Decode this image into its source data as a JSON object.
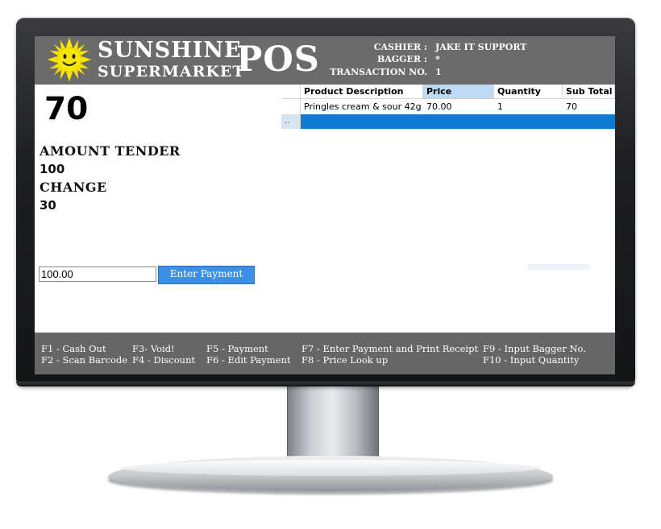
{
  "brand": {
    "name": "SUNSHINE",
    "sub": "SUPERMARKET",
    "pos": "POS",
    "logo": "smiling-sun-icon",
    "colors": {
      "sun": "#f7e600",
      "header": "#6b6b6b"
    }
  },
  "info": {
    "cashier_label": "CASHIER :",
    "cashier_value": "JAKE IT SUPPORT",
    "bagger_label": "BAGGER :",
    "bagger_value": "*",
    "transaction_label": "TRANSACTION NO.",
    "transaction_value": "1"
  },
  "summary": {
    "total": "70",
    "amount_tender_label": "AMOUNT TENDER",
    "amount_tender_value": "100",
    "change_label": "CHANGE",
    "change_value": "30"
  },
  "payment": {
    "input_value": "100.00",
    "button_label": "Enter Payment"
  },
  "grid": {
    "columns": [
      "Product Description",
      "Price",
      "Quantity",
      "Sub Total"
    ],
    "selected_column": "Price",
    "rows": [
      [
        "Pringles cream & sour 42g",
        "70.00",
        "1",
        "70"
      ]
    ],
    "new_row_marker": "..",
    "colors": {
      "selected_header": "#bcdbf3",
      "new_row": "#0d7bd4"
    }
  },
  "shortcuts": {
    "f1": "F1 - Cash Out",
    "f2": "F2 - Scan Barcode",
    "f3": "F3- Void!",
    "f4": "F4 - Discount",
    "f5": "F5 - Payment",
    "f6": "F6 - Edit Payment",
    "f7": "F7 - Enter Payment and Print Receipt",
    "f8": "F8 - Price Look up",
    "f9": "F9 - Input Bagger No.",
    "f10": "F10 - Input Quantity"
  }
}
